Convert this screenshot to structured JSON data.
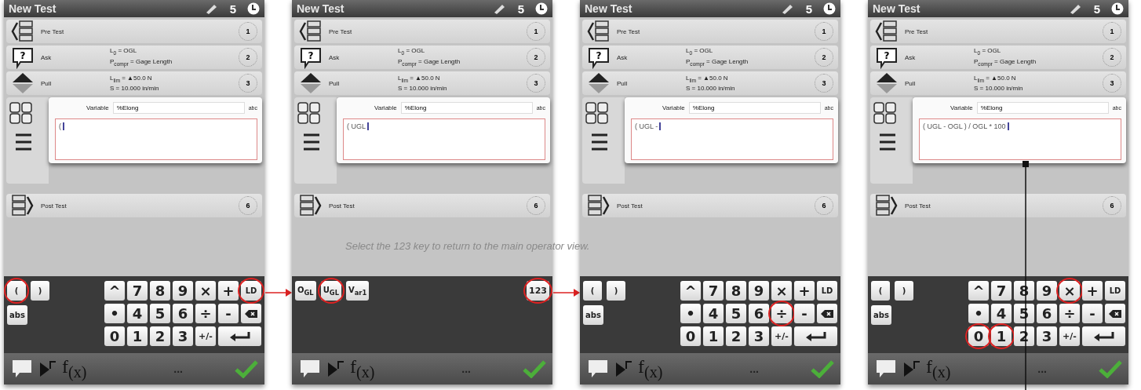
{
  "caption": "Select the 123 key to return to the main operator view.",
  "panels": [
    {
      "title": "New Test",
      "status_count": "5",
      "arrow_to_next": true,
      "leader_line": false,
      "steps": [
        {
          "kind": "pre",
          "name": "Pre Test",
          "number": "1"
        },
        {
          "kind": "ask",
          "name": "Ask",
          "icon_label": "?",
          "details": [
            "L$_{0}$ = OGL",
            "P$_{compr}$ = Gage Length"
          ],
          "number": "2"
        },
        {
          "kind": "pull",
          "name": "Pull",
          "details": [
            "L$_{lim}$ = ▲50.0 N",
            "S = 10.000 in/min"
          ],
          "number": "3"
        },
        {
          "kind": "calculation",
          "variable_label": "Variable",
          "variable_value": "%Elong",
          "value_type": "abc",
          "expression": "("
        },
        {
          "kind": "post",
          "name": "Post Test",
          "number": "6"
        }
      ],
      "keyboard": {
        "kind": "numeric",
        "left_keys": [
          {
            "label": "(",
            "circled": true
          },
          {
            "label": ")",
            "circled": false
          },
          {
            "label": "abs",
            "circled": false
          }
        ],
        "keys": [
          {
            "kind": "text",
            "label": "^",
            "circled": false
          },
          {
            "kind": "text",
            "label": "7",
            "circled": false
          },
          {
            "kind": "text",
            "label": "8",
            "circled": false
          },
          {
            "kind": "text",
            "label": "9",
            "circled": false
          },
          {
            "kind": "text",
            "label": "×",
            "circled": false
          },
          {
            "kind": "text",
            "label": "+",
            "circled": false
          },
          {
            "kind": "text",
            "label": "LD",
            "circled": true
          },
          {
            "kind": "text",
            "label": "•",
            "circled": false
          },
          {
            "kind": "text",
            "label": "4",
            "circled": false
          },
          {
            "kind": "text",
            "label": "5",
            "circled": false
          },
          {
            "kind": "text",
            "label": "6",
            "circled": false
          },
          {
            "kind": "text",
            "label": "÷",
            "circled": false
          },
          {
            "kind": "text",
            "label": "-",
            "circled": false
          },
          {
            "kind": "backspace",
            "circled": false
          },
          {
            "kind": "text",
            "label": "0",
            "circled": false
          },
          {
            "kind": "text",
            "label": "1",
            "circled": false
          },
          {
            "kind": "text",
            "label": "2",
            "circled": false
          },
          {
            "kind": "text",
            "label": "3",
            "circled": false
          },
          {
            "kind": "text",
            "label": "+/-",
            "circled": false
          },
          {
            "kind": "enter",
            "circled": false
          }
        ]
      },
      "toolbar": {
        "function_label": "f$_{(x)}$",
        "more_label": "..."
      }
    },
    {
      "title": "New Test",
      "status_count": "5",
      "arrow_to_next": true,
      "leader_line": false,
      "steps": [
        {
          "kind": "pre",
          "name": "Pre Test",
          "number": "1"
        },
        {
          "kind": "ask",
          "name": "Ask",
          "icon_label": "?",
          "details": [
            "L$_{0}$ = OGL",
            "P$_{compr}$ = Gage Length"
          ],
          "number": "2"
        },
        {
          "kind": "pull",
          "name": "Pull",
          "details": [
            "L$_{lim}$ = ▲50.0 N",
            "S = 10.000 in/min"
          ],
          "number": "3"
        },
        {
          "kind": "calculation",
          "variable_label": "Variable",
          "variable_value": "%Elong",
          "value_type": "abc",
          "expression": "( UGL"
        },
        {
          "kind": "post",
          "name": "Post Test",
          "number": "6"
        }
      ],
      "keyboard": {
        "kind": "variables",
        "left_keys": [
          {
            "label": "O$_{GL}$",
            "circled": false
          },
          {
            "label": "U$_{GL}$",
            "circled": true
          },
          {
            "label": "V$_{ar1}$",
            "circled": false
          }
        ],
        "right_keys": [
          {
            "label": "123",
            "circled": true
          }
        ]
      },
      "toolbar": {
        "function_label": "f$_{(x)}$",
        "more_label": "..."
      }
    },
    {
      "title": "New Test",
      "status_count": "5",
      "arrow_to_next": false,
      "leader_line": false,
      "steps": [
        {
          "kind": "pre",
          "name": "Pre Test",
          "number": "1"
        },
        {
          "kind": "ask",
          "name": "Ask",
          "icon_label": "?",
          "details": [
            "L$_{0}$ = OGL",
            "P$_{compr}$ = Gage Length"
          ],
          "number": "2"
        },
        {
          "kind": "pull",
          "name": "Pull",
          "details": [
            "L$_{lim}$ = ▲50.0 N",
            "S = 10.000 in/min"
          ],
          "number": "3"
        },
        {
          "kind": "calculation",
          "variable_label": "Variable",
          "variable_value": "%Elong",
          "value_type": "abc",
          "expression": "( UGL -"
        },
        {
          "kind": "post",
          "name": "Post Test",
          "number": "6"
        }
      ],
      "keyboard": {
        "kind": "numeric",
        "left_keys": [
          {
            "label": "(",
            "circled": false
          },
          {
            "label": ")",
            "circled": false
          },
          {
            "label": "abs",
            "circled": false
          }
        ],
        "keys": [
          {
            "kind": "text",
            "label": "^",
            "circled": false
          },
          {
            "kind": "text",
            "label": "7",
            "circled": false
          },
          {
            "kind": "text",
            "label": "8",
            "circled": false
          },
          {
            "kind": "text",
            "label": "9",
            "circled": false
          },
          {
            "kind": "text",
            "label": "×",
            "circled": false
          },
          {
            "kind": "text",
            "label": "+",
            "circled": false
          },
          {
            "kind": "text",
            "label": "LD",
            "circled": false
          },
          {
            "kind": "text",
            "label": "•",
            "circled": false
          },
          {
            "kind": "text",
            "label": "4",
            "circled": false
          },
          {
            "kind": "text",
            "label": "5",
            "circled": false
          },
          {
            "kind": "text",
            "label": "6",
            "circled": false
          },
          {
            "kind": "text",
            "label": "÷",
            "circled": true
          },
          {
            "kind": "text",
            "label": "-",
            "circled": false
          },
          {
            "kind": "backspace",
            "circled": false
          },
          {
            "kind": "text",
            "label": "0",
            "circled": false
          },
          {
            "kind": "text",
            "label": "1",
            "circled": false
          },
          {
            "kind": "text",
            "label": "2",
            "circled": false
          },
          {
            "kind": "text",
            "label": "3",
            "circled": false
          },
          {
            "kind": "text",
            "label": "+/-",
            "circled": false
          },
          {
            "kind": "enter",
            "circled": false
          }
        ]
      },
      "toolbar": {
        "function_label": "f$_{(x)}$",
        "more_label": "..."
      }
    },
    {
      "title": "New Test",
      "status_count": "5",
      "arrow_to_next": false,
      "leader_line": true,
      "steps": [
        {
          "kind": "pre",
          "name": "Pre Test",
          "number": "1"
        },
        {
          "kind": "ask",
          "name": "Ask",
          "icon_label": "?",
          "details": [
            "L$_{0}$ = OGL",
            "P$_{compr}$ = Gage Length"
          ],
          "number": "2"
        },
        {
          "kind": "pull",
          "name": "Pull",
          "details": [
            "L$_{lim}$ = ▲50.0 N",
            "S = 10.000 in/min"
          ],
          "number": "3"
        },
        {
          "kind": "calculation",
          "variable_label": "Variable",
          "variable_value": "%Elong",
          "value_type": "abc",
          "expression": "( UGL - OGL ) / OGL * 100"
        },
        {
          "kind": "post",
          "name": "Post Test",
          "number": "6"
        }
      ],
      "keyboard": {
        "kind": "numeric",
        "left_keys": [
          {
            "label": "(",
            "circled": false
          },
          {
            "label": ")",
            "circled": false
          },
          {
            "label": "abs",
            "circled": false
          }
        ],
        "keys": [
          {
            "kind": "text",
            "label": "^",
            "circled": false
          },
          {
            "kind": "text",
            "label": "7",
            "circled": false
          },
          {
            "kind": "text",
            "label": "8",
            "circled": false
          },
          {
            "kind": "text",
            "label": "9",
            "circled": false
          },
          {
            "kind": "text",
            "label": "×",
            "circled": true
          },
          {
            "kind": "text",
            "label": "+",
            "circled": false
          },
          {
            "kind": "text",
            "label": "LD",
            "circled": false
          },
          {
            "kind": "text",
            "label": "•",
            "circled": false
          },
          {
            "kind": "text",
            "label": "4",
            "circled": false
          },
          {
            "kind": "text",
            "label": "5",
            "circled": false
          },
          {
            "kind": "text",
            "label": "6",
            "circled": false
          },
          {
            "kind": "text",
            "label": "÷",
            "circled": false
          },
          {
            "kind": "text",
            "label": "-",
            "circled": false
          },
          {
            "kind": "backspace",
            "circled": false
          },
          {
            "kind": "text",
            "label": "0",
            "circled": true
          },
          {
            "kind": "text",
            "label": "1",
            "circled": true
          },
          {
            "kind": "text",
            "label": "2",
            "circled": false
          },
          {
            "kind": "text",
            "label": "3",
            "circled": false
          },
          {
            "kind": "text",
            "label": "+/-",
            "circled": false
          },
          {
            "kind": "enter",
            "circled": false
          }
        ]
      },
      "toolbar": {
        "function_label": "f$_{(x)}$",
        "more_label": "..."
      }
    }
  ]
}
